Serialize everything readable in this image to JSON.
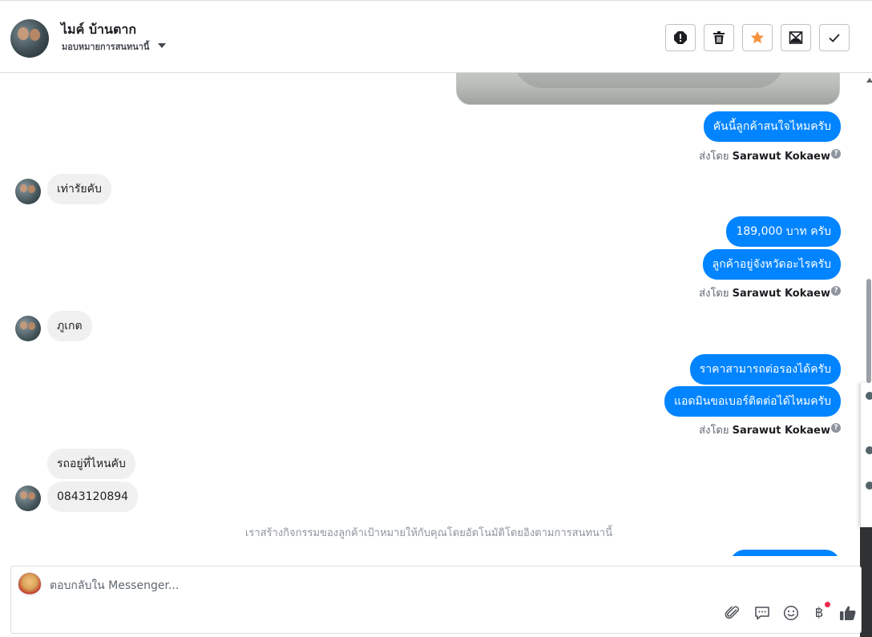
{
  "header": {
    "contact_name": "ไมค์ บ้านตาก",
    "assign_label": "มอบหมายการสนทนานี้",
    "buttons": [
      {
        "name": "spam-button",
        "icon": "exclamation-icon"
      },
      {
        "name": "delete-button",
        "icon": "trash-icon"
      },
      {
        "name": "star-button",
        "icon": "star-icon"
      },
      {
        "name": "mark-unread-button",
        "icon": "envelope-icon"
      },
      {
        "name": "mark-done-button",
        "icon": "check-icon"
      }
    ]
  },
  "messages": {
    "out_1": "คันนี้ลูกค้าสนใจไหมครับ",
    "sent_by_prefix": "ส่งโดย",
    "sent_by_name": "Sarawut Kokaew",
    "in_1": "เท่ารัยคับ",
    "out_2": "189,000 บาท ครับ",
    "out_3": "ลูกค้าอยู่จังหวัดอะไรครับ",
    "in_2": "ภูเกต",
    "out_4": "ราคาสามารถต่อรองได้ครับ",
    "out_5": "แอดมินขอเบอร์ติดต่อได้ไหมครับ",
    "in_3": "รถอยู่ที่ไหนคับ",
    "in_4": "0843120894",
    "system_note": "เราสร้างกิจกรรมของลูกค้าเป้าหมายให้กับคุณโดยอัตโนมัติโดยอิงตามการสนทนานี้"
  },
  "composer": {
    "placeholder": "ตอบกลับใน Messenger...",
    "value": "",
    "icons": [
      "paperclip-icon",
      "chat-bubble-icon",
      "emoji-icon",
      "baht-icon",
      "thumbs-up-icon"
    ],
    "baht_symbol": "฿"
  },
  "colors": {
    "outgoing_bubble": "#0084ff",
    "incoming_bubble": "#f0f0f0",
    "star": "#f5923e",
    "notification_dot": "#f0284a"
  }
}
